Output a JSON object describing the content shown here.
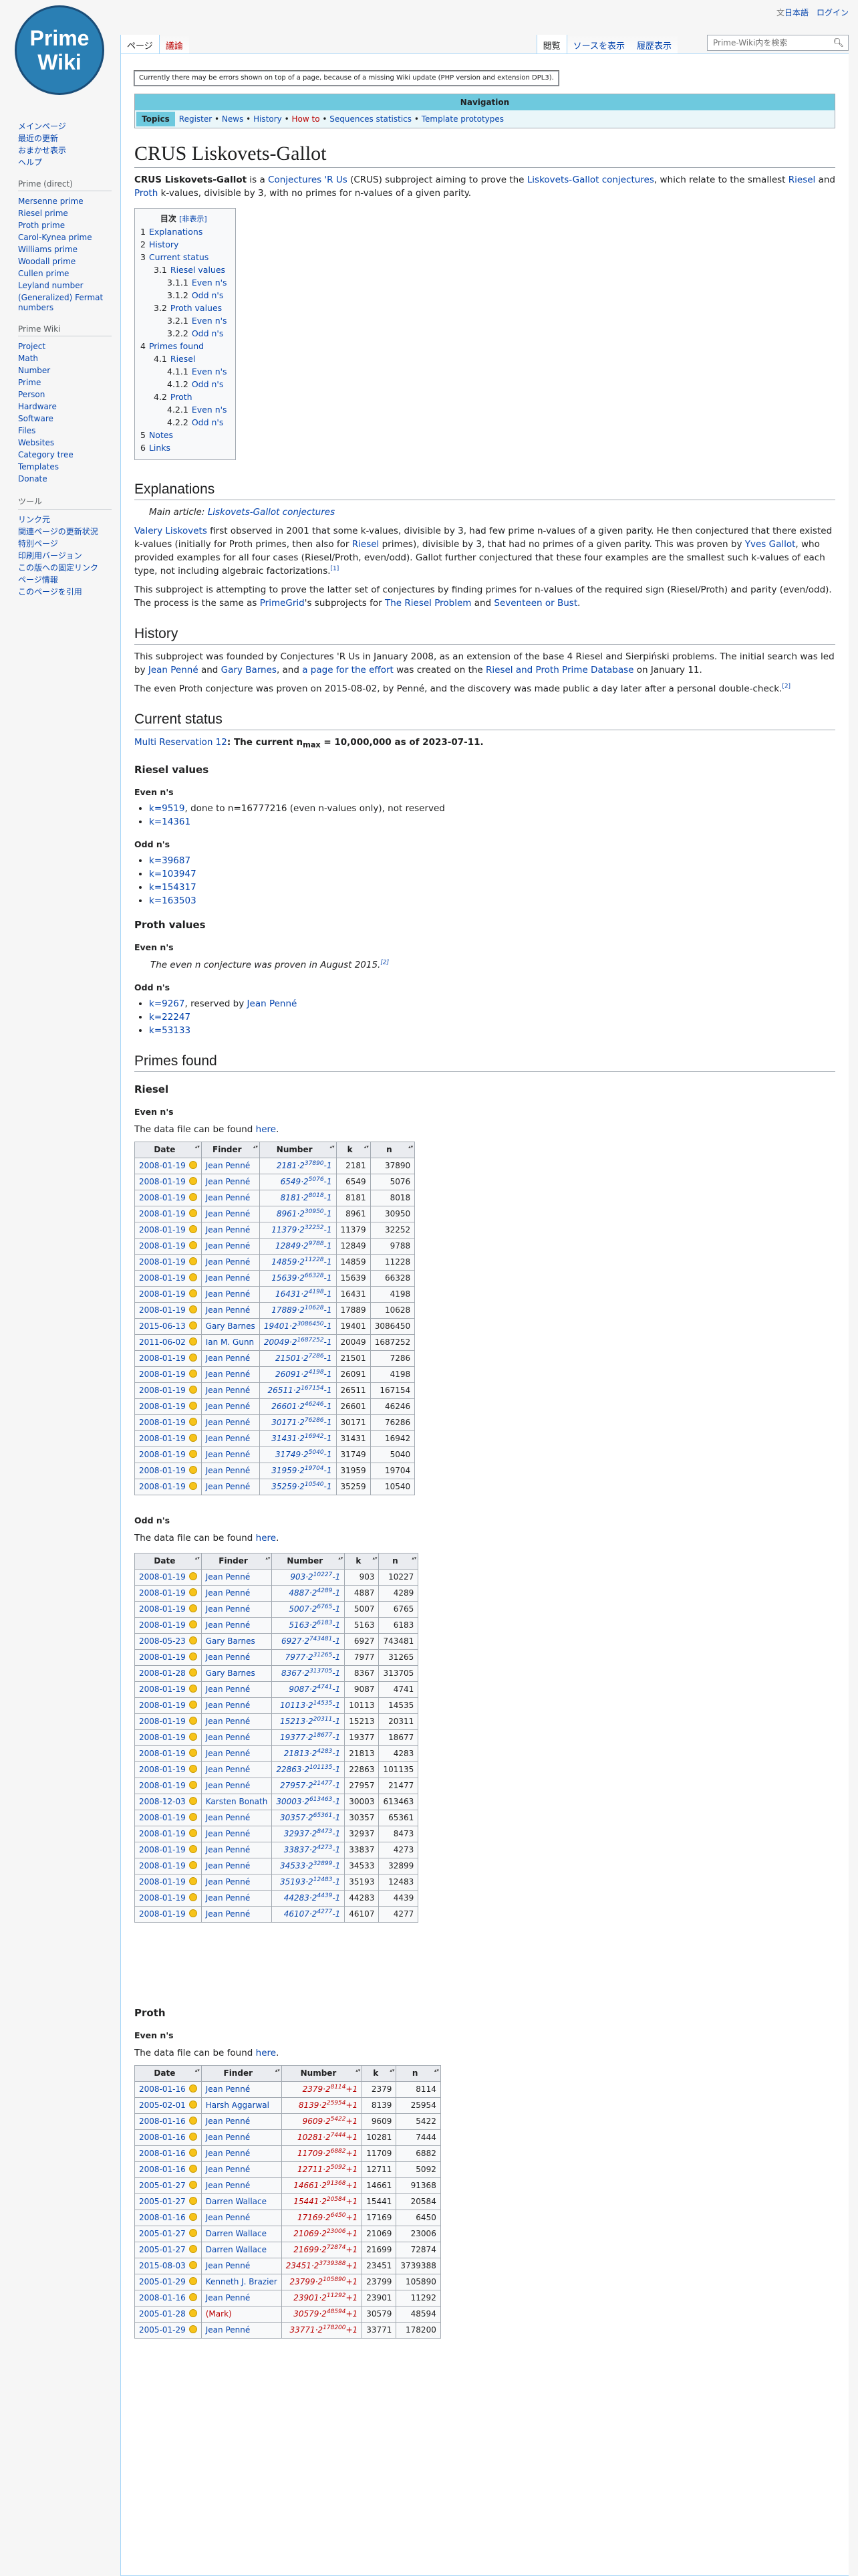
{
  "logo": {
    "line1": "Prime",
    "line2": "Wiki"
  },
  "personal": {
    "lang": "日本語",
    "login": "ログイン"
  },
  "tabs": {
    "page": "ページ",
    "talk": "議論",
    "read": "閲覧",
    "view_source": "ソースを表示",
    "history": "履歴表示"
  },
  "search": {
    "placeholder": "Prime-Wiki内を検索"
  },
  "sidebar": [
    {
      "heading": "",
      "items": [
        "メインページ",
        "最近の更新",
        "おまかせ表示",
        "ヘルプ"
      ]
    },
    {
      "heading": "Prime (direct)",
      "items": [
        "Mersenne prime",
        "Riesel prime",
        "Proth prime",
        "Carol-Kynea prime",
        "Williams prime",
        "Woodall prime",
        "Cullen prime",
        "Leyland number",
        "(Generalized) Fermat numbers"
      ]
    },
    {
      "heading": "Prime Wiki",
      "items": [
        "Project",
        "Math",
        "Number",
        "Prime",
        "Person",
        "Hardware",
        "Software",
        "Files",
        "Websites",
        "Category tree",
        "Templates",
        "Donate"
      ]
    },
    {
      "heading": "ツール",
      "items": [
        "リンク元",
        "関連ページの更新状況",
        "特別ページ",
        "印刷用バージョン",
        "この版への固定リンク",
        "ページ情報",
        "このページを引用"
      ]
    }
  ],
  "sitenotice": "Currently there may be errors shown on top of a page, because of a missing Wiki update (PHP version and extension DPL3).",
  "navbox": {
    "title": "Navigation",
    "label": "Topics",
    "links": [
      {
        "text": "Register",
        "red": false
      },
      {
        "text": "News",
        "red": false
      },
      {
        "text": "History",
        "red": false
      },
      {
        "text": "How to",
        "red": true
      },
      {
        "text": "Sequences statistics",
        "red": false
      },
      {
        "text": "Template prototypes",
        "red": false
      }
    ]
  },
  "page_title": "CRUS Liskovets-Gallot",
  "intro": {
    "t1": "CRUS Liskovets-Gallot",
    "t2": " is a ",
    "l1": "Conjectures 'R Us",
    "t3": " (CRUS) subproject aiming to prove the ",
    "l2": "Liskovets-Gallot conjectures",
    "t4": ", which relate to the smallest ",
    "l3": "Riesel",
    "t5": " and ",
    "l4": "Proth",
    "t6": " k-values, divisible by 3, with no primes for n-values of a given parity."
  },
  "toc": {
    "title": "目次",
    "toggle": "[非表示]",
    "items": [
      {
        "num": "1",
        "text": "Explanations",
        "lv": 1
      },
      {
        "num": "2",
        "text": "History",
        "lv": 1
      },
      {
        "num": "3",
        "text": "Current status",
        "lv": 1
      },
      {
        "num": "3.1",
        "text": "Riesel values",
        "lv": 2
      },
      {
        "num": "3.1.1",
        "text": "Even n's",
        "lv": 3
      },
      {
        "num": "3.1.2",
        "text": "Odd n's",
        "lv": 3
      },
      {
        "num": "3.2",
        "text": "Proth values",
        "lv": 2
      },
      {
        "num": "3.2.1",
        "text": "Even n's",
        "lv": 3
      },
      {
        "num": "3.2.2",
        "text": "Odd n's",
        "lv": 3
      },
      {
        "num": "4",
        "text": "Primes found",
        "lv": 1
      },
      {
        "num": "4.1",
        "text": "Riesel",
        "lv": 2
      },
      {
        "num": "4.1.1",
        "text": "Even n's",
        "lv": 3
      },
      {
        "num": "4.1.2",
        "text": "Odd n's",
        "lv": 3
      },
      {
        "num": "4.2",
        "text": "Proth",
        "lv": 2
      },
      {
        "num": "4.2.1",
        "text": "Even n's",
        "lv": 3
      },
      {
        "num": "4.2.2",
        "text": "Odd n's",
        "lv": 3
      },
      {
        "num": "5",
        "text": "Notes",
        "lv": 1
      },
      {
        "num": "6",
        "text": "Links",
        "lv": 1
      }
    ]
  },
  "explanations": {
    "heading": "Explanations",
    "hatnote_label": "Main article: ",
    "hatnote_link": "Liskovets-Gallot conjectures",
    "p1_l1": "Valery Liskovets",
    "p1_t1": " first observed in 2001 that some k-values, divisible by 3, had few prime n-values of a given parity. He then conjectured that there existed k-values (initially for Proth primes, then also for ",
    "p1_l2": "Riesel",
    "p1_t2": " primes), divisible by 3, that had no primes of a given parity. This was proven by ",
    "p1_l3": "Yves Gallot",
    "p1_t3": ", who provided examples for all four cases (Riesel/Proth, even/odd). Gallot further conjectured that these four examples are the smallest such k-values of each type, not including algebraic factorizations.",
    "p1_ref": "[1]",
    "p2_t1": "This subproject is attempting to prove the latter set of conjectures by finding primes for n-values of the required sign (Riesel/Proth) and parity (even/odd). The process is the same as ",
    "p2_l1": "PrimeGrid",
    "p2_t2": "'s subprojects for ",
    "p2_l2": "The Riesel Problem",
    "p2_t3": " and ",
    "p2_l3": "Seventeen or Bust",
    "p2_t4": "."
  },
  "history": {
    "heading": "History",
    "p1_t1": "This subproject was founded by Conjectures 'R Us in January 2008, as an extension of the base 4 Riesel and Sierpiński problems. The initial search was led by ",
    "p1_l1": "Jean Penné",
    "p1_t2": " and ",
    "p1_l2": "Gary Barnes",
    "p1_t3": ", and ",
    "p1_l3": "a page for the effort",
    "p1_ref1": "[3]",
    "p1_t4": " was created on the ",
    "p1_l4": "Riesel and Proth Prime Database",
    "p1_t5": " on January 11.",
    "p2": "The even Proth conjecture was proven on 2015-08-02, by Penné, and the discovery was made public a day later after a personal double-check.",
    "p2_ref": "[2]"
  },
  "status": {
    "heading": "Current status",
    "reservation_link": "Multi Reservation 12",
    "reservation_text": ": The current n",
    "reservation_sub": "max",
    "reservation_val": " = 10,000,000 as of 2023-07-11.",
    "riesel_heading": "Riesel values",
    "even_heading": "Even n's",
    "odd_heading": "Odd n's",
    "riesel_even": [
      {
        "link": "k=9519",
        "text": ", done to n=16777216 (even n-values only), not reserved"
      },
      {
        "link": "k=14361",
        "text": ""
      }
    ],
    "riesel_odd": [
      "k=39687",
      "k=103947",
      "k=154317",
      "k=163503"
    ],
    "proth_heading": "Proth values",
    "proth_even_quote": "The even n conjecture was proven in August 2015.",
    "proth_even_ref": "[2]",
    "proth_odd_1_link": "k=9267",
    "proth_odd_1_text": ", reserved by ",
    "proth_odd_1_person": "Jean Penné",
    "proth_odd_rest": [
      "k=22247",
      "k=53133"
    ]
  },
  "primes": {
    "heading": "Primes found",
    "riesel_heading": "Riesel",
    "proth_heading": "Proth",
    "even_heading": "Even n's",
    "odd_heading": "Odd n's",
    "datafile_text": "The data file can be found ",
    "datafile_link": "here",
    "columns": [
      "Date",
      "Finder",
      "Number",
      "k",
      "n"
    ],
    "riesel_even_rows": [
      [
        "2008-01-19",
        "Jean Penné",
        "2181",
        "37890",
        "2181",
        "37890"
      ],
      [
        "2008-01-19",
        "Jean Penné",
        "6549",
        "5076",
        "6549",
        "5076"
      ],
      [
        "2008-01-19",
        "Jean Penné",
        "8181",
        "8018",
        "8181",
        "8018"
      ],
      [
        "2008-01-19",
        "Jean Penné",
        "8961",
        "30950",
        "8961",
        "30950"
      ],
      [
        "2008-01-19",
        "Jean Penné",
        "11379",
        "32252",
        "11379",
        "32252"
      ],
      [
        "2008-01-19",
        "Jean Penné",
        "12849",
        "9788",
        "12849",
        "9788"
      ],
      [
        "2008-01-19",
        "Jean Penné",
        "14859",
        "11228",
        "14859",
        "11228"
      ],
      [
        "2008-01-19",
        "Jean Penné",
        "15639",
        "66328",
        "15639",
        "66328"
      ],
      [
        "2008-01-19",
        "Jean Penné",
        "16431",
        "4198",
        "16431",
        "4198"
      ],
      [
        "2008-01-19",
        "Jean Penné",
        "17889",
        "10628",
        "17889",
        "10628"
      ],
      [
        "2015-06-13",
        "Gary Barnes",
        "19401",
        "3086450",
        "19401",
        "3086450"
      ],
      [
        "2011-06-02",
        "Ian M. Gunn",
        "20049",
        "1687252",
        "20049",
        "1687252"
      ],
      [
        "2008-01-19",
        "Jean Penné",
        "21501",
        "7286",
        "21501",
        "7286"
      ],
      [
        "2008-01-19",
        "Jean Penné",
        "26091",
        "4198",
        "26091",
        "4198"
      ],
      [
        "2008-01-19",
        "Jean Penné",
        "26511",
        "167154",
        "26511",
        "167154"
      ],
      [
        "2008-01-19",
        "Jean Penné",
        "26601",
        "46246",
        "26601",
        "46246"
      ],
      [
        "2008-01-19",
        "Jean Penné",
        "30171",
        "76286",
        "30171",
        "76286"
      ],
      [
        "2008-01-19",
        "Jean Penné",
        "31431",
        "16942",
        "31431",
        "16942"
      ],
      [
        "2008-01-19",
        "Jean Penné",
        "31749",
        "5040",
        "31749",
        "5040"
      ],
      [
        "2008-01-19",
        "Jean Penné",
        "31959",
        "19704",
        "31959",
        "19704"
      ],
      [
        "2008-01-19",
        "Jean Penné",
        "35259",
        "10540",
        "35259",
        "10540"
      ]
    ],
    "riesel_odd_rows": [
      [
        "2008-01-19",
        "Jean Penné",
        "903",
        "10227",
        "903",
        "10227"
      ],
      [
        "2008-01-19",
        "Jean Penné",
        "4887",
        "4289",
        "4887",
        "4289"
      ],
      [
        "2008-01-19",
        "Jean Penné",
        "5007",
        "6765",
        "5007",
        "6765"
      ],
      [
        "2008-01-19",
        "Jean Penné",
        "5163",
        "6183",
        "5163",
        "6183"
      ],
      [
        "2008-05-23",
        "Gary Barnes",
        "6927",
        "743481",
        "6927",
        "743481"
      ],
      [
        "2008-01-19",
        "Jean Penné",
        "7977",
        "31265",
        "7977",
        "31265"
      ],
      [
        "2008-01-28",
        "Gary Barnes",
        "8367",
        "313705",
        "8367",
        "313705"
      ],
      [
        "2008-01-19",
        "Jean Penné",
        "9087",
        "4741",
        "9087",
        "4741"
      ],
      [
        "2008-01-19",
        "Jean Penné",
        "10113",
        "14535",
        "10113",
        "14535"
      ],
      [
        "2008-01-19",
        "Jean Penné",
        "15213",
        "20311",
        "15213",
        "20311"
      ],
      [
        "2008-01-19",
        "Jean Penné",
        "19377",
        "18677",
        "19377",
        "18677"
      ],
      [
        "2008-01-19",
        "Jean Penné",
        "21813",
        "4283",
        "21813",
        "4283"
      ],
      [
        "2008-01-19",
        "Jean Penné",
        "22863",
        "101135",
        "22863",
        "101135"
      ],
      [
        "2008-01-19",
        "Jean Penné",
        "27957",
        "21477",
        "27957",
        "21477"
      ],
      [
        "2008-12-03",
        "Karsten Bonath",
        "30003",
        "613463",
        "30003",
        "613463"
      ],
      [
        "2008-01-19",
        "Jean Penné",
        "30357",
        "65361",
        "30357",
        "65361"
      ],
      [
        "2008-01-19",
        "Jean Penné",
        "32937",
        "8473",
        "32937",
        "8473"
      ],
      [
        "2008-01-19",
        "Jean Penné",
        "33837",
        "4273",
        "33837",
        "4273"
      ],
      [
        "2008-01-19",
        "Jean Penné",
        "34533",
        "32899",
        "34533",
        "32899"
      ],
      [
        "2008-01-19",
        "Jean Penné",
        "35193",
        "12483",
        "35193",
        "12483"
      ],
      [
        "2008-01-19",
        "Jean Penné",
        "44283",
        "4439",
        "44283",
        "4439"
      ],
      [
        "2008-01-19",
        "Jean Penné",
        "46107",
        "4277",
        "46107",
        "4277"
      ]
    ],
    "proth_even_rows": [
      [
        "2008-01-16",
        "Jean Penné",
        "2379",
        "8114",
        "2379",
        "8114",
        false
      ],
      [
        "2005-02-01",
        "Harsh Aggarwal",
        "8139",
        "25954",
        "8139",
        "25954",
        false
      ],
      [
        "2008-01-16",
        "Jean Penné",
        "9609",
        "5422",
        "9609",
        "5422",
        false
      ],
      [
        "2008-01-16",
        "Jean Penné",
        "10281",
        "7444",
        "10281",
        "7444",
        false
      ],
      [
        "2008-01-16",
        "Jean Penné",
        "11709",
        "6882",
        "11709",
        "6882",
        false
      ],
      [
        "2008-01-16",
        "Jean Penné",
        "12711",
        "5092",
        "12711",
        "5092",
        false
      ],
      [
        "2005-01-27",
        "Jean Penné",
        "14661",
        "91368",
        "14661",
        "91368",
        false
      ],
      [
        "2005-01-27",
        "Darren Wallace",
        "15441",
        "20584",
        "15441",
        "20584",
        false
      ],
      [
        "2008-01-16",
        "Jean Penné",
        "17169",
        "6450",
        "17169",
        "6450",
        false
      ],
      [
        "2005-01-27",
        "Darren Wallace",
        "21069",
        "23006",
        "21069",
        "23006",
        false
      ],
      [
        "2005-01-27",
        "Darren Wallace",
        "21699",
        "72874",
        "21699",
        "72874",
        false
      ],
      [
        "2015-08-03",
        "Jean Penné",
        "23451",
        "3739388",
        "23451",
        "3739388",
        false
      ],
      [
        "2005-01-29",
        "Kenneth J. Brazier",
        "23799",
        "105890",
        "23799",
        "105890",
        false
      ],
      [
        "2008-01-16",
        "Jean Penné",
        "23901",
        "11292",
        "23901",
        "11292",
        false
      ],
      [
        "2005-01-28",
        "(Mark)",
        "30579",
        "48594",
        "30579",
        "48594",
        true
      ],
      [
        "2005-01-29",
        "Jean Penné",
        "33771",
        "178200",
        "33771",
        "178200",
        false
      ]
    ]
  }
}
